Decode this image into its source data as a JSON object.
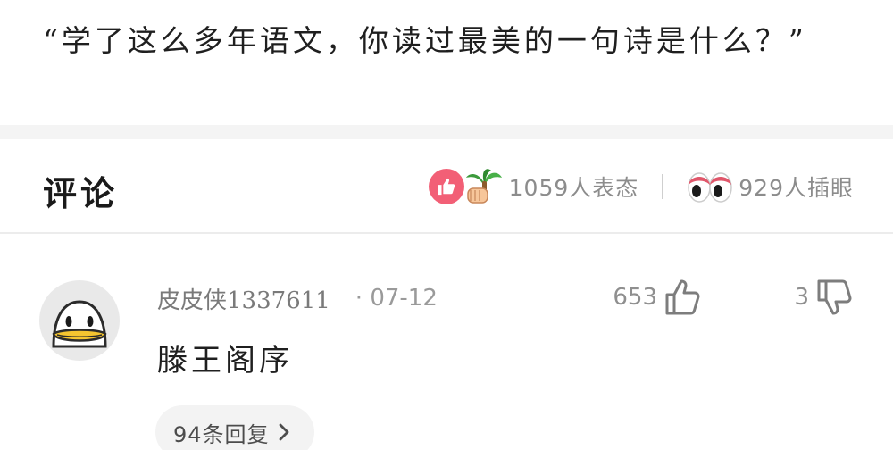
{
  "post": {
    "text": "“学了这么多年语文，你读过最美的一句诗是什么？”"
  },
  "comments_header": {
    "title": "评论",
    "reaction_summary": "1059人表态",
    "eyes_summary": "929人插眼",
    "like_icon": "thumbs-up-icon",
    "reaction_emoji": "palm-tree-hand-emoji",
    "eyes_emoji": "eyes-emoji"
  },
  "comment": {
    "author": "皮皮侠1337611",
    "date": "· 07-12",
    "upvotes": "653",
    "downvotes": "3",
    "body": "滕王阁序",
    "reply_label": "94条回复",
    "avatar_icon": "penguin-avatar",
    "upvote_icon": "thumbs-up-outline-icon",
    "downvote_icon": "thumbs-down-outline-icon",
    "chevron_icon": "chevron-right-icon"
  },
  "colors": {
    "like_badge": "#f25f76",
    "muted_text": "#8c8c8c",
    "pill_bg": "#f3f3f3",
    "band_bg": "#f4f4f4"
  }
}
